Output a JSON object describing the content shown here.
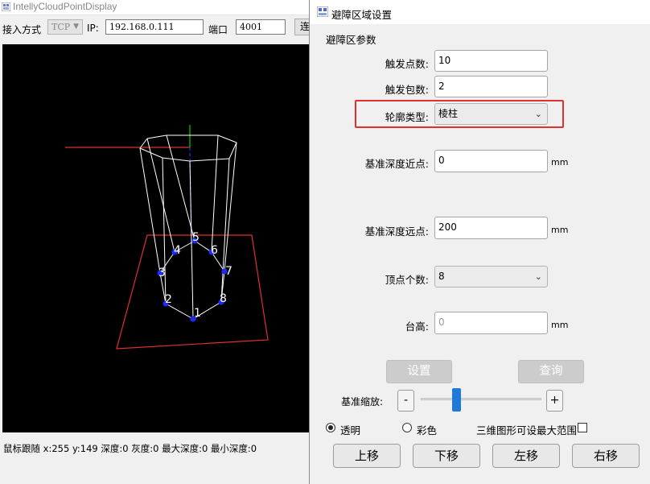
{
  "main_window": {
    "title": "IntellyCloudPointDisplay",
    "toolbar": {
      "access_label": "接入方式",
      "access_value": "TCP",
      "ip_label": "IP:",
      "ip_value": "192.168.0.111",
      "port_label": "端口",
      "port_value": "4001",
      "connect_label": "连"
    },
    "viewport": {
      "point_labels": [
        "1",
        "2",
        "3",
        "4",
        "5",
        "6",
        "7",
        "8"
      ],
      "colors": {
        "background": "#000000",
        "wireframe": "#ffffff",
        "region_outline": "#e03030",
        "points": "#1a2cff",
        "axis_green": "#00cc00",
        "axis_blue": "#2030ff"
      }
    },
    "status": "鼠标跟随 x:255 y:149 深度:0 灰度:0 最大深度:0 最小深度:0"
  },
  "dialog": {
    "title": "避障区域设置",
    "group_label": "避障区参数",
    "trigger_points": {
      "label": "触发点数:",
      "value": "10"
    },
    "trigger_packets": {
      "label": "触发包数:",
      "value": "2"
    },
    "contour_type": {
      "label": "轮廓类型:",
      "value": "棱柱"
    },
    "near_depth": {
      "label": "基准深度近点:",
      "value": "0",
      "unit": "mm"
    },
    "far_depth": {
      "label": "基准深度远点:",
      "value": "200",
      "unit": "mm"
    },
    "vertex_count": {
      "label": "顶点个数:",
      "value": "8"
    },
    "platform_height": {
      "label": "台高:",
      "value": "0",
      "unit": "mm"
    },
    "set_button": "设置",
    "query_button": "查询",
    "zoom": {
      "label": "基准缩放:",
      "minus": "-",
      "plus": "+",
      "level": 0.28
    },
    "radio_transparent": "透明",
    "radio_color": "彩色",
    "checkbox_label": "三维图形可设最大范围",
    "move_up": "上移",
    "move_down": "下移",
    "move_left": "左移",
    "move_right": "右移",
    "highlight_color": "#e03030"
  }
}
